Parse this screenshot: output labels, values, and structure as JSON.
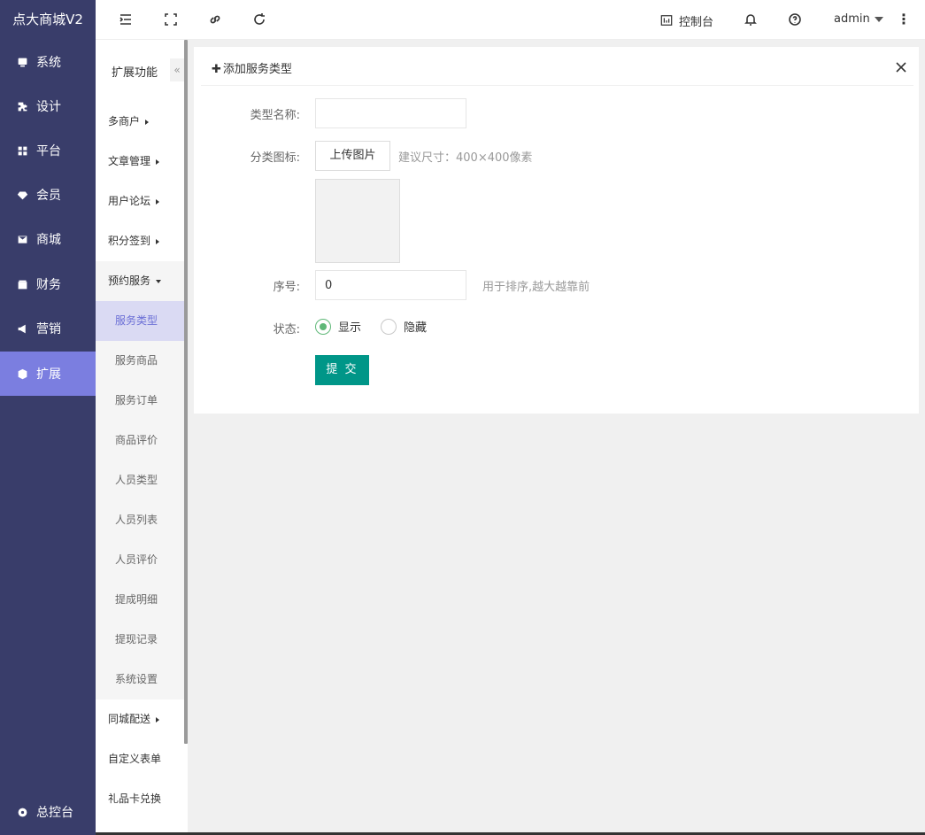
{
  "app": {
    "title": "点大商城V2"
  },
  "main_nav": [
    {
      "label": "系统",
      "icon": "monitor-icon"
    },
    {
      "label": "设计",
      "icon": "puzzle-icon"
    },
    {
      "label": "平台",
      "icon": "grid-icon"
    },
    {
      "label": "会员",
      "icon": "diamond-icon"
    },
    {
      "label": "商城",
      "icon": "mail-icon"
    },
    {
      "label": "财务",
      "icon": "wallet-icon"
    },
    {
      "label": "营销",
      "icon": "megaphone-icon"
    },
    {
      "label": "扩展",
      "icon": "cube-icon",
      "active": true
    }
  ],
  "bottom_nav": {
    "label": "总控台",
    "icon": "gear-icon"
  },
  "sub_nav": {
    "title": "扩展功能",
    "collapse_glyph": "«",
    "groups": [
      {
        "label": "多商户"
      },
      {
        "label": "文章管理"
      },
      {
        "label": "用户论坛"
      },
      {
        "label": "积分签到"
      },
      {
        "label": "预约服务",
        "open": true
      }
    ],
    "items": [
      {
        "label": "服务类型",
        "active": true
      },
      {
        "label": "服务商品"
      },
      {
        "label": "服务订单"
      },
      {
        "label": "商品评价"
      },
      {
        "label": "人员类型"
      },
      {
        "label": "人员列表"
      },
      {
        "label": "人员评价"
      },
      {
        "label": "提成明细"
      },
      {
        "label": "提现记录"
      },
      {
        "label": "系统设置"
      }
    ],
    "after": [
      {
        "label": "同城配送",
        "arrow": true
      },
      {
        "label": "自定义表单"
      },
      {
        "label": "礼品卡兑换"
      }
    ]
  },
  "topbar": {
    "console_label": "控制台",
    "user": "admin"
  },
  "form": {
    "title": "添加服务类型",
    "plus": "✚",
    "name_label": "类型名称:",
    "name_value": "",
    "icon_label": "分类图标:",
    "upload_label": "上传图片",
    "icon_hint": "建议尺寸：400×400像素",
    "order_label": "序号:",
    "order_value": "0",
    "order_hint": "用于排序,越大越靠前",
    "status_label": "状态:",
    "status_options": [
      "显示",
      "隐藏"
    ],
    "status_selected": "显示",
    "submit_label": "提 交"
  },
  "colors": {
    "sidebar_bg": "#393d6a",
    "sidebar_active": "#7b7ee0",
    "submit_bg": "#009688",
    "radio_on": "#5fb878"
  }
}
